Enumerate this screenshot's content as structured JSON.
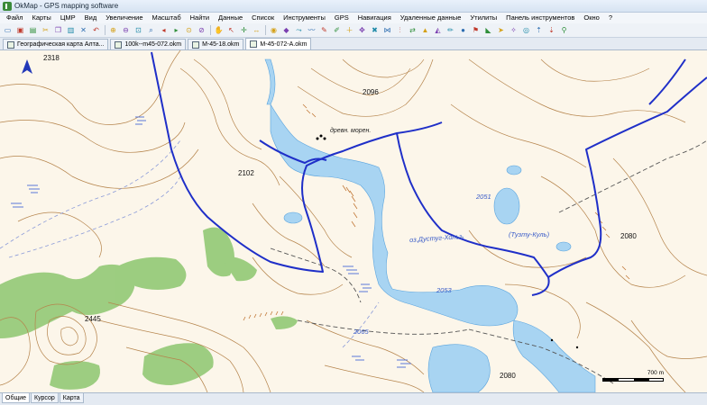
{
  "window": {
    "title": "OkMap - GPS mapping software"
  },
  "menu": [
    {
      "label": "Файл"
    },
    {
      "label": "Карты"
    },
    {
      "label": "ЦМР"
    },
    {
      "label": "Вид"
    },
    {
      "label": "Увеличение"
    },
    {
      "label": "Масштаб"
    },
    {
      "label": "Найти"
    },
    {
      "label": "Данные"
    },
    {
      "label": "Список"
    },
    {
      "label": "Инструменты"
    },
    {
      "label": "GPS"
    },
    {
      "label": "Навигация"
    },
    {
      "label": "Удаленные данные"
    },
    {
      "label": "Утилиты"
    },
    {
      "label": "Панель инструментов"
    },
    {
      "label": "Окно"
    },
    {
      "label": "?"
    }
  ],
  "toolbar": {
    "groups": [
      [
        {
          "icon": "open-icon"
        },
        {
          "icon": "save-icon"
        },
        {
          "icon": "print-icon"
        },
        {
          "icon": "cut-icon"
        },
        {
          "icon": "copy-icon"
        },
        {
          "icon": "paste-icon"
        },
        {
          "icon": "delete-icon"
        },
        {
          "icon": "undo-icon"
        }
      ],
      [
        {
          "icon": "zoom-in-icon"
        },
        {
          "icon": "zoom-out-icon"
        },
        {
          "icon": "zoom-fit-icon"
        },
        {
          "icon": "zoom-window-icon"
        },
        {
          "icon": "zoom-prev-icon"
        },
        {
          "icon": "zoom-next-icon"
        },
        {
          "icon": "zoom-level-icon"
        },
        {
          "icon": "zoom-reset-icon"
        }
      ],
      [
        {
          "icon": "pan-hand-icon"
        },
        {
          "icon": "select-arrow-icon"
        },
        {
          "icon": "crosshair-icon"
        },
        {
          "icon": "measure-icon"
        }
      ],
      [
        {
          "icon": "gps-icon"
        },
        {
          "icon": "waypoint-icon"
        },
        {
          "icon": "route-icon"
        },
        {
          "icon": "track-icon"
        },
        {
          "icon": "edit-route-icon"
        },
        {
          "icon": "edit-track-icon"
        },
        {
          "icon": "add-point-icon"
        },
        {
          "icon": "move-point-icon"
        },
        {
          "icon": "delete-point-icon"
        },
        {
          "icon": "join-icon"
        },
        {
          "icon": "split-icon"
        },
        {
          "icon": "reverse-icon"
        },
        {
          "icon": "altitude-icon"
        },
        {
          "icon": "profile-icon"
        },
        {
          "icon": "pencil-icon"
        },
        {
          "icon": "marker-icon"
        },
        {
          "icon": "flag-icon"
        },
        {
          "icon": "bookmark-icon"
        },
        {
          "icon": "navigate-icon"
        },
        {
          "icon": "compass-icon"
        },
        {
          "icon": "target-icon"
        },
        {
          "icon": "gps-send-icon"
        },
        {
          "icon": "gps-receive-icon"
        },
        {
          "icon": "gps-live-icon"
        }
      ]
    ]
  },
  "tabs": [
    {
      "label": "Географическая карта Алта...",
      "active": false
    },
    {
      "label": "100k--m45-072.okm",
      "active": false
    },
    {
      "label": "M-45-18.okm",
      "active": false
    },
    {
      "label": "M-45-072-A.okm",
      "active": true
    }
  ],
  "map": {
    "elevation_labels": [
      {
        "text": "2318"
      },
      {
        "text": "2096"
      },
      {
        "text": "2102"
      },
      {
        "text": "2051"
      },
      {
        "text": "2080"
      },
      {
        "text": "2445"
      },
      {
        "text": "2053"
      },
      {
        "text": "2065"
      },
      {
        "text": "2080"
      }
    ],
    "water_labels": [
      {
        "text": "оз.Дустуг-Хольъ"
      },
      {
        "text": "(Тузту-Куль)"
      }
    ],
    "text_labels": [
      {
        "text": "древн. морен."
      }
    ],
    "scale": {
      "label": "700 m"
    },
    "colors": {
      "background": "#fcf6ea",
      "contour": "#b5844c",
      "water": "#99ccf0",
      "forest": "#8cc66e",
      "track": "#1f2fc8"
    }
  },
  "status_tabs": [
    {
      "label": "Общие",
      "active": true
    },
    {
      "label": "Курсор",
      "active": false
    },
    {
      "label": "Карта",
      "active": false
    }
  ]
}
